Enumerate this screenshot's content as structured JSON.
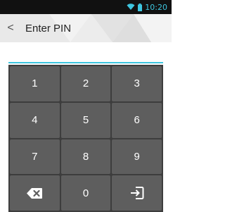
{
  "status_bar": {
    "time": "10:20",
    "icons": [
      "wifi-icon",
      "battery-icon"
    ],
    "accent": "#3ec6e0"
  },
  "app_bar": {
    "back_icon": "chevron-left-icon",
    "back_glyph": "<",
    "title": "Enter PIN"
  },
  "pin_field": {
    "value": "",
    "underline_color": "#3ec6e0"
  },
  "keypad": {
    "keys": [
      "1",
      "2",
      "3",
      "4",
      "5",
      "6",
      "7",
      "8",
      "9"
    ],
    "bottom_row": {
      "delete_icon": "backspace-icon",
      "zero": "0",
      "submit_icon": "login-icon"
    }
  }
}
